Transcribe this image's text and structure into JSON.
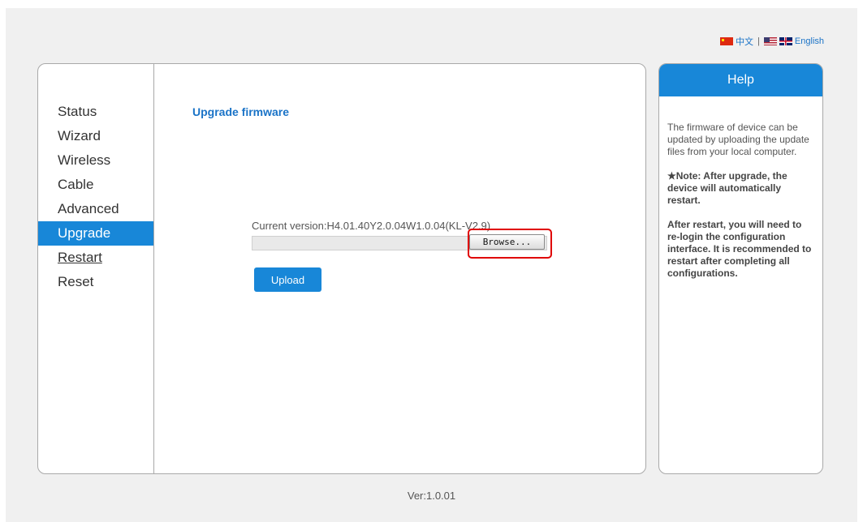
{
  "language": {
    "chinese_label": "中文",
    "separator": "|",
    "english_label": "English"
  },
  "sidebar": {
    "items": [
      {
        "label": "Status"
      },
      {
        "label": "Wizard"
      },
      {
        "label": "Wireless"
      },
      {
        "label": "Cable"
      },
      {
        "label": "Advanced"
      },
      {
        "label": "Upgrade",
        "active": true
      },
      {
        "label": "Restart"
      },
      {
        "label": "Reset"
      }
    ]
  },
  "main": {
    "title": "Upgrade firmware",
    "current_version": "Current version:H4.01.40Y2.0.04W1.0.04(KL-V2.9)",
    "file_input_value": "",
    "browse_label": "Browse...",
    "upload_label": "Upload"
  },
  "help": {
    "title": "Help",
    "paragraph1": "The firmware of device can be updated by uploading the update files from your local computer.",
    "note": "★Note: After upgrade, the device will automatically restart.",
    "paragraph3": "After restart, you will need to re-login the configuration interface. It is recommended to restart after completing all configurations."
  },
  "footer": {
    "version": "Ver:1.0.01"
  },
  "colors": {
    "accent": "#1887d8",
    "highlight": "#e00000",
    "background": "#f0f0f0"
  }
}
